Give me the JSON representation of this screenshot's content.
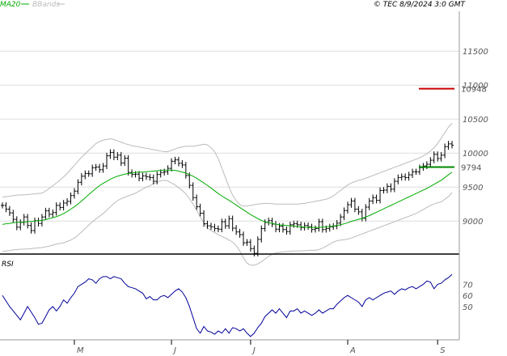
{
  "header": {
    "legend": [
      {
        "label": "MA20",
        "color": "#00aa00"
      },
      {
        "label": "BBands",
        "color": "#bbbbbb"
      }
    ],
    "stamp": "© TEC 8/9/2024 3:0 GMT"
  },
  "colors": {
    "bars": "#000000",
    "ma20": "#00aa00",
    "bbands": "#bbbbbb",
    "rsi": "#000099",
    "resistance": "#cc0000",
    "support": "#008800",
    "grid": "#dddddd"
  },
  "chart_data": [
    {
      "type": "line",
      "panel": "price",
      "y_ticks": [
        {
          "value": 9000,
          "label": "9000"
        },
        {
          "value": 9500,
          "label": "9500"
        },
        {
          "value": 10000,
          "label": "10000"
        },
        {
          "value": 10500,
          "label": "10500"
        },
        {
          "value": 11000,
          "label": "11000"
        },
        {
          "value": 11500,
          "label": "11500"
        }
      ],
      "ylim": [
        8800,
        11800
      ],
      "x_ticks": [
        {
          "index": 20,
          "label": "M"
        },
        {
          "index": 47,
          "label": "J"
        },
        {
          "index": 69,
          "label": "J"
        },
        {
          "index": 96,
          "label": "A"
        },
        {
          "index": 121,
          "label": "S"
        }
      ],
      "x_count": 126,
      "close": [
        9230,
        9175,
        9120,
        9025,
        8910,
        8980,
        9060,
        8935,
        8860,
        9005,
        8965,
        9060,
        9150,
        9100,
        9125,
        9230,
        9200,
        9265,
        9290,
        9375,
        9440,
        9570,
        9660,
        9700,
        9695,
        9785,
        9795,
        9755,
        9810,
        9960,
        10010,
        9940,
        9970,
        9855,
        9925,
        9715,
        9685,
        9690,
        9630,
        9665,
        9650,
        9640,
        9585,
        9685,
        9715,
        9725,
        9775,
        9880,
        9900,
        9850,
        9825,
        9670,
        9525,
        9345,
        9210,
        9115,
        8960,
        8930,
        8915,
        8890,
        8880,
        8990,
        8930,
        9035,
        8895,
        8840,
        8800,
        8680,
        8690,
        8595,
        8525,
        8730,
        8890,
        8980,
        9005,
        8955,
        8880,
        8925,
        8875,
        8845,
        8945,
        8960,
        8945,
        8905,
        8935,
        8915,
        8875,
        8890,
        8990,
        8875,
        8890,
        8915,
        8925,
        8970,
        9060,
        9155,
        9240,
        9295,
        9175,
        9135,
        9040,
        9205,
        9295,
        9345,
        9305,
        9450,
        9455,
        9510,
        9470,
        9585,
        9640,
        9655,
        9640,
        9680,
        9725,
        9725,
        9785,
        9810,
        9835,
        9895,
        9980,
        9920,
        9970,
        10095,
        10135,
        10115
      ],
      "ma20": [
        8950,
        8960,
        8965,
        8975,
        8980,
        8985,
        8985,
        8990,
        8995,
        9000,
        9005,
        9010,
        9020,
        9035,
        9050,
        9065,
        9085,
        9110,
        9140,
        9175,
        9210,
        9250,
        9295,
        9340,
        9390,
        9435,
        9480,
        9520,
        9555,
        9585,
        9615,
        9640,
        9660,
        9675,
        9690,
        9700,
        9705,
        9715,
        9720,
        9720,
        9725,
        9730,
        9735,
        9740,
        9745,
        9750,
        9750,
        9750,
        9745,
        9735,
        9720,
        9705,
        9685,
        9660,
        9630,
        9595,
        9560,
        9525,
        9485,
        9445,
        9405,
        9370,
        9335,
        9305,
        9270,
        9235,
        9200,
        9165,
        9130,
        9095,
        9065,
        9035,
        9010,
        8990,
        8975,
        8965,
        8955,
        8945,
        8940,
        8935,
        8930,
        8925,
        8920,
        8915,
        8910,
        8905,
        8905,
        8905,
        8905,
        8910,
        8915,
        8920,
        8925,
        8935,
        8945,
        8960,
        8975,
        8995,
        9010,
        9025,
        9040,
        9060,
        9080,
        9105,
        9130,
        9155,
        9180,
        9205,
        9230,
        9255,
        9280,
        9305,
        9330,
        9355,
        9380,
        9405,
        9430,
        9455,
        9480,
        9510,
        9540,
        9570,
        9600,
        9640,
        9680,
        9720
      ],
      "bb_upper": [
        9350,
        9360,
        9365,
        9375,
        9380,
        9385,
        9385,
        9390,
        9395,
        9400,
        9405,
        9410,
        9440,
        9480,
        9520,
        9560,
        9600,
        9650,
        9700,
        9760,
        9820,
        9880,
        9940,
        9990,
        10040,
        10090,
        10140,
        10170,
        10190,
        10200,
        10210,
        10200,
        10180,
        10160,
        10140,
        10125,
        10110,
        10100,
        10090,
        10080,
        10070,
        10060,
        10050,
        10040,
        10030,
        10020,
        10020,
        10040,
        10060,
        10080,
        10090,
        10100,
        10100,
        10100,
        10110,
        10120,
        10130,
        10120,
        10080,
        10020,
        9920,
        9780,
        9640,
        9500,
        9380,
        9300,
        9240,
        9220,
        9220,
        9230,
        9240,
        9250,
        9255,
        9260,
        9260,
        9255,
        9250,
        9250,
        9250,
        9250,
        9250,
        9250,
        9250,
        9255,
        9260,
        9270,
        9280,
        9290,
        9300,
        9310,
        9320,
        9340,
        9370,
        9410,
        9450,
        9490,
        9530,
        9560,
        9580,
        9600,
        9610,
        9630,
        9650,
        9670,
        9690,
        9710,
        9730,
        9750,
        9770,
        9790,
        9810,
        9830,
        9850,
        9870,
        9890,
        9910,
        9930,
        9960,
        9990,
        10030,
        10080,
        10140,
        10220,
        10300,
        10380,
        10440
      ],
      "bb_lower": [
        8550,
        8560,
        8565,
        8575,
        8580,
        8585,
        8585,
        8590,
        8595,
        8600,
        8605,
        8610,
        8620,
        8630,
        8645,
        8660,
        8670,
        8680,
        8700,
        8720,
        8750,
        8790,
        8840,
        8890,
        8940,
        8990,
        9030,
        9070,
        9110,
        9160,
        9210,
        9260,
        9300,
        9330,
        9350,
        9370,
        9390,
        9410,
        9440,
        9470,
        9500,
        9520,
        9550,
        9570,
        9590,
        9600,
        9590,
        9560,
        9530,
        9490,
        9450,
        9400,
        9330,
        9250,
        9160,
        9060,
        8970,
        8900,
        8860,
        8830,
        8800,
        8775,
        8750,
        8720,
        8690,
        8640,
        8560,
        8460,
        8380,
        8350,
        8350,
        8370,
        8400,
        8440,
        8480,
        8510,
        8530,
        8540,
        8545,
        8550,
        8555,
        8560,
        8560,
        8560,
        8565,
        8570,
        8570,
        8570,
        8580,
        8600,
        8630,
        8660,
        8690,
        8710,
        8720,
        8725,
        8735,
        8750,
        8770,
        8790,
        8810,
        8830,
        8850,
        8870,
        8890,
        8910,
        8930,
        8950,
        8970,
        8990,
        9010,
        9030,
        9050,
        9070,
        9090,
        9110,
        9140,
        9170,
        9200,
        9230,
        9250,
        9270,
        9280,
        9320,
        9360,
        9420
      ],
      "levels": [
        {
          "value": 10948,
          "label": "10948",
          "color": "#cc0000"
        },
        {
          "value": 9794,
          "label": "9794",
          "color": "#008800"
        }
      ]
    },
    {
      "type": "line",
      "panel": "rsi",
      "label": "RSI",
      "y_ticks": [
        {
          "value": 50,
          "label": "50"
        },
        {
          "value": 60,
          "label": "60"
        },
        {
          "value": 70,
          "label": "70"
        }
      ],
      "ylim": [
        20,
        90
      ],
      "values": [
        60,
        55,
        50,
        46,
        42,
        38,
        44,
        50,
        45,
        40,
        34,
        35,
        41,
        47,
        50,
        46,
        50,
        56,
        53,
        58,
        62,
        68,
        70,
        72,
        75,
        74,
        71,
        75,
        77,
        77,
        75,
        77,
        76,
        75,
        71,
        68,
        67,
        66,
        64,
        62,
        57,
        59,
        56,
        56,
        59,
        60,
        58,
        61,
        64,
        66,
        63,
        58,
        50,
        40,
        30,
        26,
        32,
        28,
        27,
        25,
        28,
        26,
        30,
        26,
        31,
        30,
        28,
        30,
        26,
        23,
        26,
        31,
        35,
        41,
        44,
        47,
        44,
        48,
        44,
        40,
        46,
        46,
        48,
        44,
        46,
        44,
        42,
        44,
        47,
        44,
        46,
        48,
        48,
        52,
        55,
        58,
        60,
        58,
        56,
        54,
        50,
        56,
        58,
        56,
        58,
        60,
        62,
        63,
        64,
        61,
        64,
        66,
        65,
        67,
        68,
        66,
        68,
        70,
        73,
        72,
        66,
        70,
        71,
        74,
        76,
        79
      ]
    }
  ]
}
